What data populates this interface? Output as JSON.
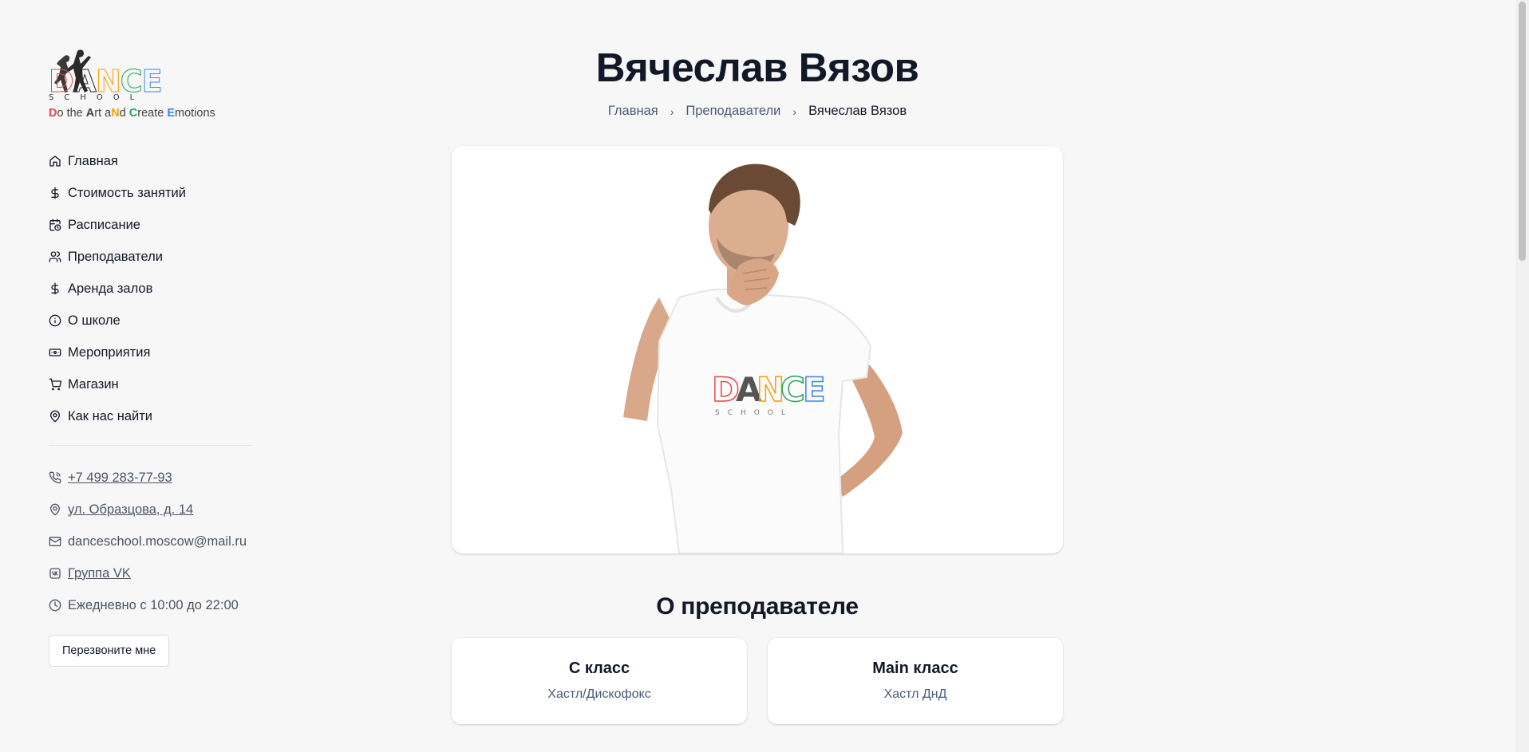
{
  "brand": {
    "logo_word": [
      "D",
      "A",
      "N",
      "C",
      "E"
    ],
    "logo_colors": [
      "#e5484d",
      "#222222",
      "#f59e0b",
      "#22a559",
      "#3b82f6"
    ],
    "logo_sub": "SCHOOL",
    "tagline_parts": [
      {
        "t": "D",
        "c": "#e5484d",
        "b": true
      },
      {
        "t": "o the ",
        "c": "#444444",
        "b": false
      },
      {
        "t": "A",
        "c": "#444444",
        "b": true
      },
      {
        "t": "rt a",
        "c": "#444444",
        "b": false
      },
      {
        "t": "N",
        "c": "#f59e0b",
        "b": true
      },
      {
        "t": "d ",
        "c": "#444444",
        "b": false
      },
      {
        "t": "C",
        "c": "#22a559",
        "b": true
      },
      {
        "t": "reate ",
        "c": "#444444",
        "b": false
      },
      {
        "t": "E",
        "c": "#3b82f6",
        "b": true
      },
      {
        "t": "motions",
        "c": "#444444",
        "b": false
      }
    ]
  },
  "nav": [
    {
      "label": "Главная",
      "icon": "home-icon"
    },
    {
      "label": "Стоимость занятий",
      "icon": "dollar-icon"
    },
    {
      "label": "Расписание",
      "icon": "calendar-clock-icon"
    },
    {
      "label": "Преподаватели",
      "icon": "users-icon"
    },
    {
      "label": "Аренда залов",
      "icon": "dollar-icon"
    },
    {
      "label": "О школе",
      "icon": "info-icon"
    },
    {
      "label": "Мероприятия",
      "icon": "ticket-icon"
    },
    {
      "label": "Магазин",
      "icon": "cart-icon"
    },
    {
      "label": "Как нас найти",
      "icon": "map-pin-icon"
    }
  ],
  "contacts": {
    "phone": "+7 499 283-77-93",
    "address": "ул. Образцова, д. 14",
    "email": "danceschool.moscow@mail.ru",
    "vk": "Группа VK",
    "hours": "Ежедневно с 10:00 до 22:00"
  },
  "callback_label": "Перезвоните мне",
  "page": {
    "title": "Вячеслав Вязов",
    "breadcrumbs": [
      "Главная",
      "Преподаватели",
      "Вячеслав Вязов"
    ],
    "section_title": "О преподавателе",
    "classes": [
      {
        "title": "C класс",
        "subtitle": "Хастл/Дискофокс"
      },
      {
        "title": "Main класс",
        "subtitle": "Хастл ДнД"
      }
    ]
  }
}
